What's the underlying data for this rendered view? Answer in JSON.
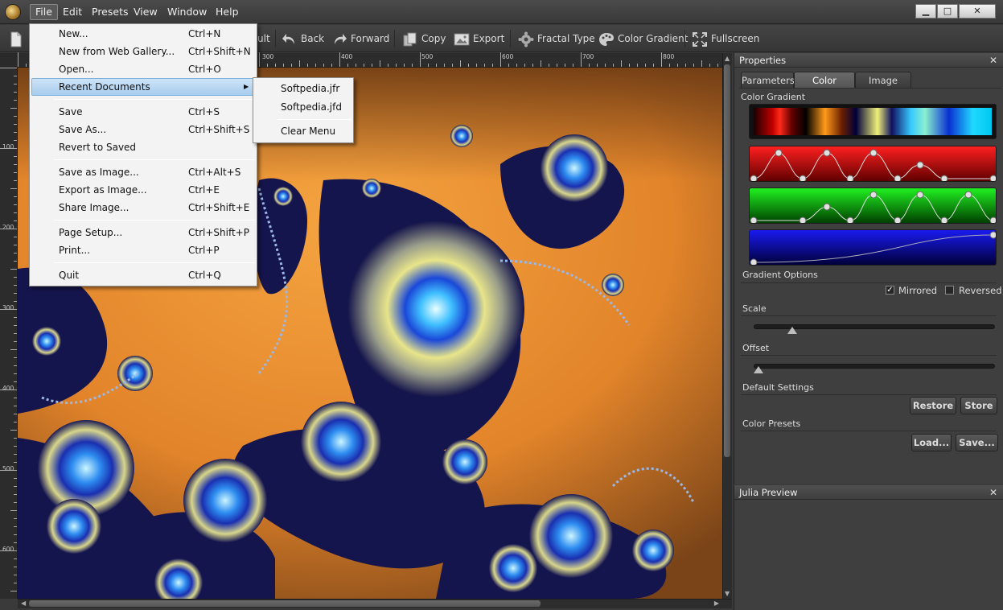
{
  "menubar": {
    "items": [
      "File",
      "Edit",
      "Presets",
      "View",
      "Window",
      "Help"
    ],
    "window_buttons": {
      "minimize": "▁",
      "maximize": "□",
      "close": "✕"
    }
  },
  "toolbar": {
    "default_label": "ult",
    "back": "Back",
    "forward": "Forward",
    "copy": "Copy",
    "export": "Export",
    "fractal_type": "Fractal Type",
    "color_gradient": "Color Gradient",
    "fullscreen": "Fullscreen"
  },
  "ruler": {
    "top_labels": [
      "300",
      "400",
      "500",
      "600",
      "700",
      "800"
    ],
    "left_labels": [
      "100",
      "200",
      "300",
      "400",
      "500",
      "600"
    ]
  },
  "file_menu": {
    "items": [
      {
        "label": "New...",
        "shortcut": "Ctrl+N"
      },
      {
        "label": "New from Web Gallery...",
        "shortcut": "Ctrl+Shift+N"
      },
      {
        "label": "Open...",
        "shortcut": "Ctrl+O"
      },
      {
        "label": "Recent Documents",
        "shortcut": ""
      },
      {
        "label": "Save",
        "shortcut": "Ctrl+S"
      },
      {
        "label": "Save As...",
        "shortcut": "Ctrl+Shift+S"
      },
      {
        "label": "Revert to Saved",
        "shortcut": ""
      },
      {
        "label": "Save as Image...",
        "shortcut": "Ctrl+Alt+S"
      },
      {
        "label": "Export as Image...",
        "shortcut": "Ctrl+E"
      },
      {
        "label": "Share Image...",
        "shortcut": "Ctrl+Shift+E"
      },
      {
        "label": "Page Setup...",
        "shortcut": "Ctrl+Shift+P"
      },
      {
        "label": "Print...",
        "shortcut": "Ctrl+P"
      },
      {
        "label": "Quit",
        "shortcut": "Ctrl+Q"
      }
    ]
  },
  "recent_menu": {
    "items": [
      "Softpedia.jfr",
      "Softpedia.jfd"
    ],
    "clear": "Clear Menu"
  },
  "properties": {
    "title": "Properties",
    "close": "✕",
    "tabs": [
      "Parameters",
      "Color",
      "Image"
    ],
    "active_tab": "Color",
    "color_gradient_label": "Color Gradient",
    "gradient_options_label": "Gradient Options",
    "mirrored_label": "Mirrored",
    "mirrored_checked": true,
    "reversed_label": "Reversed",
    "reversed_checked": false,
    "scale_label": "Scale",
    "scale_value": 0.14,
    "offset_label": "Offset",
    "offset_value": 0.0,
    "default_settings_label": "Default Settings",
    "restore_button": "Restore",
    "store_button": "Store",
    "color_presets_label": "Color Presets",
    "load_button": "Load...",
    "save_button": "Save..."
  },
  "julia": {
    "title": "Julia Preview",
    "close": "✕"
  },
  "colors": {
    "accent_highlight": "#a8cdee",
    "fractal_background": "#e88a2a",
    "fractal_dark": "#141450"
  }
}
